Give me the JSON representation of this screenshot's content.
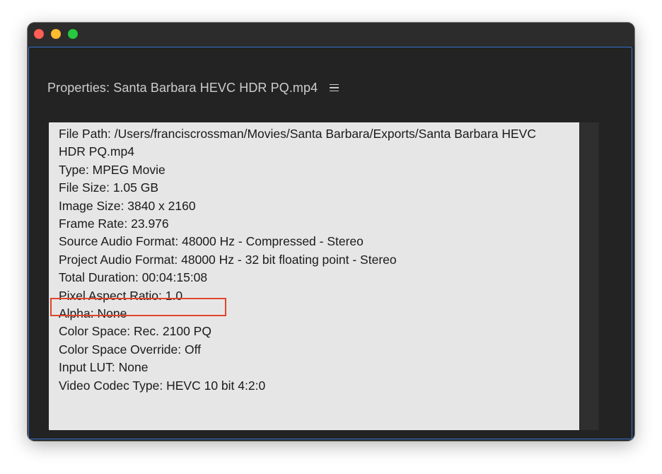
{
  "window": {
    "controls": {
      "close_icon": "close-icon",
      "minimize_icon": "minimize-icon",
      "zoom_icon": "zoom-icon"
    }
  },
  "panel": {
    "title": "Properties: Santa Barbara HEVC HDR PQ.mp4",
    "menu_icon": "hamburger-menu-icon"
  },
  "properties": {
    "lines": [
      "File Path: /Users/franciscrossman/Movies/Santa Barbara/Exports/Santa Barbara HEVC",
      "HDR PQ.mp4",
      "Type: MPEG Movie",
      "File Size: 1.05 GB",
      "Image Size: 3840 x 2160",
      "Frame Rate: 23.976",
      "Source Audio Format: 48000 Hz - Compressed - Stereo",
      "Project Audio Format: 48000 Hz - 32 bit floating point - Stereo",
      "Total Duration: 00:04:15:08",
      "Pixel Aspect Ratio: 1.0",
      "Alpha: None",
      "Color Space: Rec. 2100 PQ",
      "Color Space Override: Off",
      "Input LUT: None",
      "Video Codec Type: HEVC 10 bit  4:2:0"
    ],
    "highlighted_line": "Color Space: Rec. 2100 PQ"
  },
  "colors": {
    "highlight_border": "#e0452b",
    "panel_focus_border": "#3a78d6",
    "window_background": "#232323",
    "info_background": "#e6e6e6"
  }
}
